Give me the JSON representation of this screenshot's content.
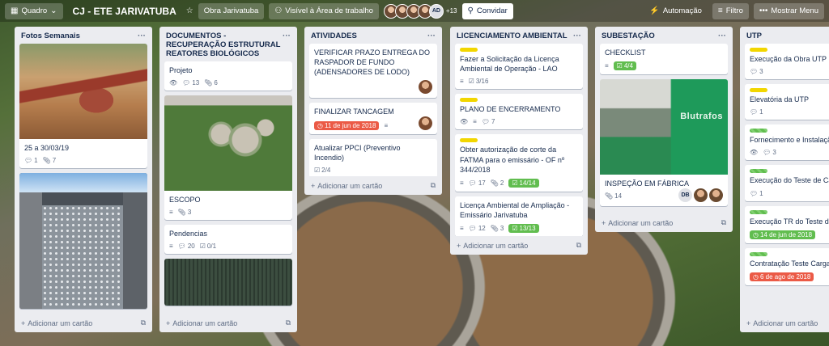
{
  "header": {
    "board_view": "Quadro",
    "board_title": "CJ - ETE JARIVATUBA",
    "team": "Obra Jarivatuba",
    "visibility": "Visível à Área de trabalho",
    "avatar_initials": "AD",
    "more_members": "+13",
    "invite": "Convidar",
    "automation": "Automação",
    "filter": "Filtro",
    "menu": "Mostrar Menu"
  },
  "lists": [
    {
      "title": "Fotos Semanais",
      "cards": [
        {
          "title": "25 a 30/03/19",
          "comments": "1",
          "attachments": "7"
        }
      ],
      "add_label": "Adicionar um cartão"
    },
    {
      "title": "DOCUMENTOS - RECUPERAÇÃO ESTRUTURAL REATORES BIOLÓGICOS",
      "cards": [
        {
          "title": "Projeto",
          "comments": "13",
          "attachments": "6"
        },
        {
          "title": "ESCOPO",
          "attachments": "3"
        },
        {
          "title": "Pendencias",
          "comments": "20",
          "checklist": "0/1"
        }
      ],
      "add_label": "Adicionar um cartão"
    },
    {
      "title": "ATIVIDADES",
      "cards": [
        {
          "title": "VERIFICAR PRAZO ENTREGA DO RASPADOR DE FUNDO (ADENSADORES DE LODO)"
        },
        {
          "title": "FINALIZAR TANCAGEM",
          "due": "11 de jun de 2018"
        },
        {
          "title": "Atualizar PPCI (Preventivo Incendio)",
          "checklist": "2/4"
        }
      ],
      "add_label": "Adicionar um cartão"
    },
    {
      "title": "LICENCIAMENTO AMBIENTAL",
      "cards": [
        {
          "title": "Fazer a Solicitação da Licença Ambiental de Operação - LAO",
          "checklist": "3/16"
        },
        {
          "title": "PLANO DE ENCERRAMENTO",
          "comments": "7"
        },
        {
          "title": "Obter autorização de corte da FATMA para o emissário - OF nº 344/2018",
          "comments": "17",
          "attachments": "2",
          "checklist": "14/14"
        },
        {
          "title": "Licença Ambiental de Ampliação - Emissário Jarivatuba",
          "comments": "12",
          "attachments": "3",
          "checklist": "13/13"
        }
      ],
      "add_label": "Adicionar um cartão"
    },
    {
      "title": "SUBESTAÇÃO",
      "cards": [
        {
          "title": "CHECKLIST",
          "checklist": "4/4"
        },
        {
          "title": "INSPEÇÃO EM FÁBRICA",
          "attachments": "14",
          "member_initials": "DB",
          "cover_text": "Blutrafos"
        }
      ],
      "add_label": "Adicionar um cartão"
    },
    {
      "title": "UTP",
      "cards": [
        {
          "title": "Execução da Obra UTP",
          "comments": "3"
        },
        {
          "title": "Elevatória da UTP",
          "comments": "1"
        },
        {
          "title": "Fornecimento e Instalação Equipamento",
          "comments": "3"
        },
        {
          "title": "Execução do Teste de Car",
          "comments": "1"
        },
        {
          "title": "Execução TR do Teste de",
          "due": "14 de jun de 2018"
        },
        {
          "title": "Contratação Teste Carga",
          "due": "6 de ago de 2018"
        }
      ],
      "add_label": "Adicionar um cartão"
    }
  ],
  "colors": {
    "green_badge": "#61bd4f",
    "red_badge": "#eb5a46",
    "yellow_label": "#f2d600",
    "list_bg": "#ebecf0"
  }
}
